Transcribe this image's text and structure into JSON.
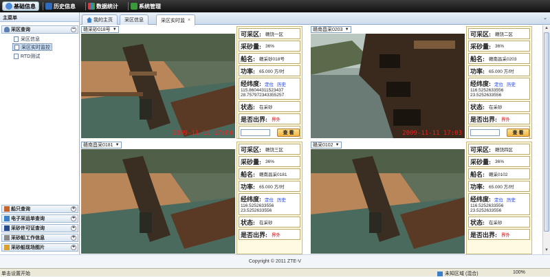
{
  "nav": [
    {
      "label": "基础信息",
      "icon": "home-icon",
      "color": "#4a8ad8"
    },
    {
      "label": "历史信息",
      "icon": "history-icon",
      "color": "#2e6cc0"
    },
    {
      "label": "数据统计",
      "icon": "chart-icon",
      "color": "#d04040"
    },
    {
      "label": "系统管理",
      "icon": "settings-icon",
      "color": "#3a9a3a"
    }
  ],
  "sidebar": {
    "title": "主菜单",
    "top_group": "采区查询",
    "items": [
      "采区信息",
      "采区实时监控",
      "RTD测试"
    ],
    "bottom_groups": [
      "船只查询",
      "电子采运单查询",
      "采砂许可证查询",
      "采砂船工作信息",
      "采砂船现场图片"
    ]
  },
  "tabs": [
    "我的主页",
    "采区信息",
    "采区实时监"
  ],
  "labels": {
    "area": "可采区:",
    "sand": "采砂量:",
    "ship": "船名:",
    "power": "功率:",
    "geo": "经纬度:",
    "locate": "定位",
    "history": "历史",
    "state": "状态:",
    "out": "是否出界:",
    "view": "查 看"
  },
  "cameras": [
    {
      "select": "赣采砂018号",
      "area": "赣饶一区",
      "sand": "36%",
      "ship": "赣采砂018号",
      "power": "65.000 方/时",
      "lng": "115.86044311523437",
      "lat": "28.757972343355257",
      "state": "在采砂",
      "out": "界外",
      "timestamp": "2009-11-11 17:04",
      "query": true
    },
    {
      "select": "赣南昌采0203",
      "area": "赣饶二区",
      "sand": "36%",
      "ship": "赣南昌采0203",
      "power": "65.000 方/时",
      "lng": "116.5252633556",
      "lat": "23.5252633556",
      "state": "在采砂",
      "out": "界外",
      "timestamp": "2009-11-11 17:03",
      "query": true
    },
    {
      "select": "赣南昌采0181",
      "area": "赣饶三区",
      "sand": "36%",
      "ship": "赣南昌采0181",
      "power": "65.000 方/时",
      "lng": "116.5252633556",
      "lat": "23.5252633556",
      "state": "在采砂",
      "out": "界外",
      "timestamp": "",
      "query": false
    },
    {
      "select": "赣采0102",
      "area": "赣饶四区",
      "sand": "36%",
      "ship": "赣采0102",
      "power": "65.000 方/时",
      "lng": "116.5252633556",
      "lat": "23.5252633556",
      "state": "在采砂",
      "out": "界外",
      "timestamp": "",
      "query": false
    }
  ],
  "footer": "Copyright © 2011 ZTE-V",
  "status": {
    "left": "单击设置开始",
    "zone": "未知区域 (混合)",
    "zoom": "100%"
  }
}
